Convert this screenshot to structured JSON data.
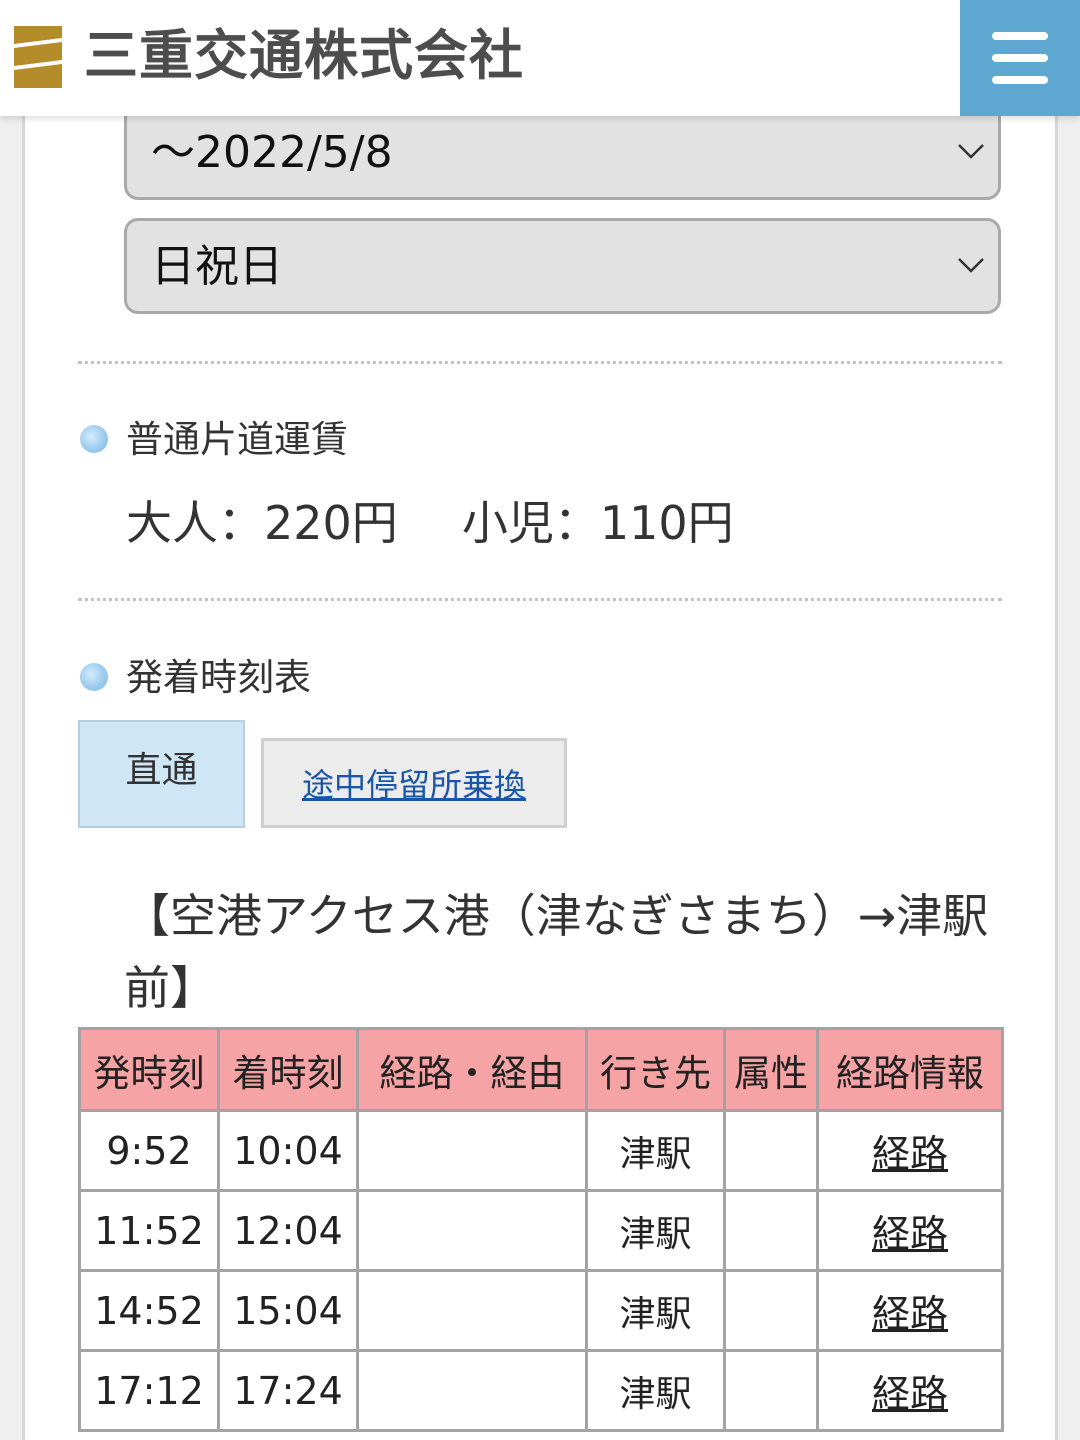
{
  "header": {
    "company_name": "三重交通株式会社",
    "menu_accent": "#5da7d0",
    "logo_color": "#b48c2a"
  },
  "filters": {
    "date_value": "〜2022/5/8",
    "day_type_value": "日祝日"
  },
  "fare": {
    "section_title": "普通片道運賃",
    "adult": "大人：220円",
    "child": "小児：110円"
  },
  "timetable_section": {
    "section_title": "発着時刻表",
    "tabs": [
      {
        "label": "直通",
        "active": true
      },
      {
        "label": "途中停留所乗換",
        "active": false
      }
    ],
    "route_title": "【空港アクセス港（津なぎさまち）→津駅前】",
    "columns": [
      "発時刻",
      "着時刻",
      "経路・経由",
      "行き先",
      "属性",
      "経路情報"
    ],
    "rows": [
      {
        "depart": "9:52",
        "arrive": "10:04",
        "via": "",
        "dest": "津駅",
        "attr": "",
        "route_link": "経路"
      },
      {
        "depart": "11:52",
        "arrive": "12:04",
        "via": "",
        "dest": "津駅",
        "attr": "",
        "route_link": "経路"
      },
      {
        "depart": "14:52",
        "arrive": "15:04",
        "via": "",
        "dest": "津駅",
        "attr": "",
        "route_link": "経路"
      },
      {
        "depart": "17:12",
        "arrive": "17:24",
        "via": "",
        "dest": "津駅",
        "attr": "",
        "route_link": "経路"
      }
    ],
    "header_color": "#f6a3a6"
  }
}
